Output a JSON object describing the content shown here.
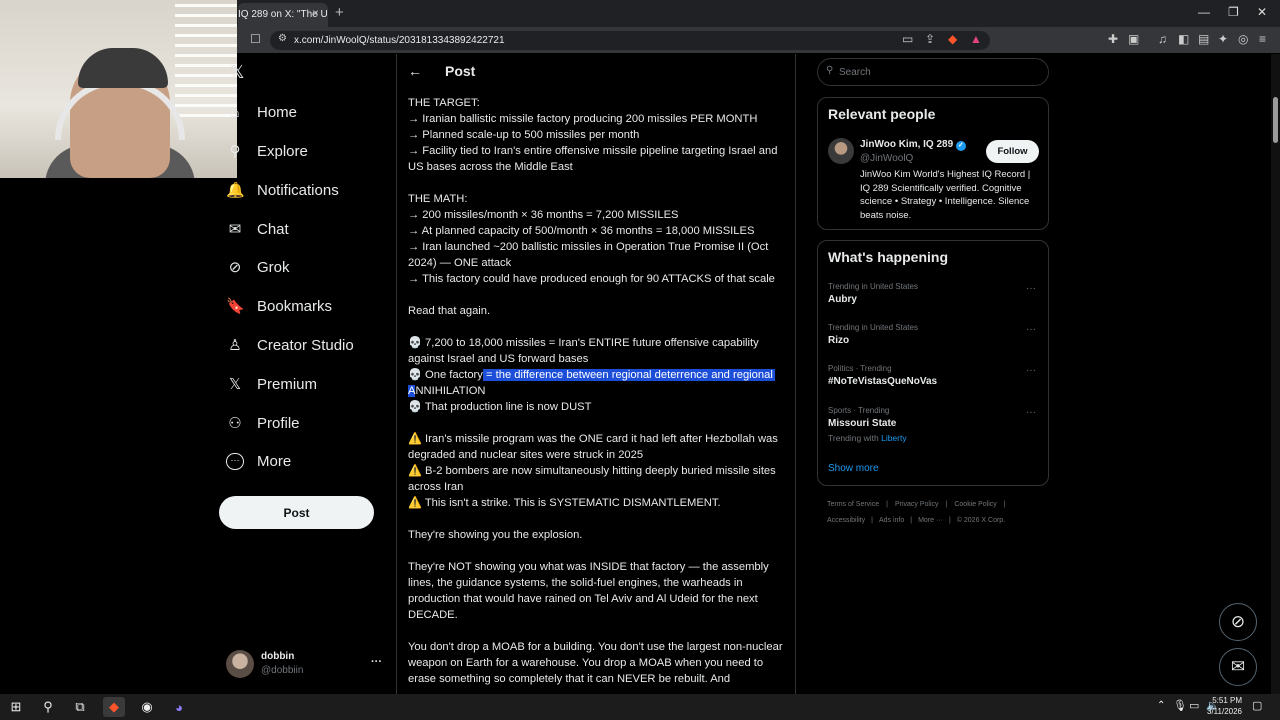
{
  "browser": {
    "tab_title": "IQ 289 on X: \"The U",
    "tab_close": "×",
    "new_tab": "+",
    "url": "x.com/JinWoolQ/status/2031813343892422721",
    "win_min": "—",
    "win_max": "❐",
    "win_close": "✕"
  },
  "nav": {
    "items": [
      {
        "label": "Home",
        "icon": "home-icon",
        "glyph": "⌂"
      },
      {
        "label": "Explore",
        "icon": "search-icon",
        "glyph": "⚲"
      },
      {
        "label": "Notifications",
        "icon": "bell-icon",
        "glyph": "🔔"
      },
      {
        "label": "Chat",
        "icon": "mail-icon",
        "glyph": "✉"
      },
      {
        "label": "Grok",
        "icon": "grok-icon",
        "glyph": "⊘"
      },
      {
        "label": "Bookmarks",
        "icon": "bookmark-icon",
        "glyph": "🔖"
      },
      {
        "label": "Creator Studio",
        "icon": "creator-studio-icon",
        "glyph": "♙"
      },
      {
        "label": "Premium",
        "icon": "x-logo-icon",
        "glyph": "𝕏"
      },
      {
        "label": "Profile",
        "icon": "person-icon",
        "glyph": "⚇"
      },
      {
        "label": "More",
        "icon": "more-circle-icon",
        "glyph": "⋯"
      }
    ],
    "post_button": "Post",
    "account": {
      "name": "dobbin",
      "handle": "@dobbiin",
      "more": "···"
    }
  },
  "header": {
    "back": "←",
    "title": "Post"
  },
  "post": {
    "p1": "THE TARGET:\n→ Iranian ballistic missile factory producing 200 missiles PER MONTH\n→ Planned scale-up to 500 missiles per month\n→ Facility tied to Iran's entire offensive missile pipeline targeting Israel and US bases across the Middle East",
    "p2": "THE MATH:\n→ 200 missiles/month × 36 months = 7,200 MISSILES\n→ At planned capacity of 500/month × 36 months = 18,000 MISSILES\n→ Iran launched ~200 ballistic missiles in Operation True Promise II (Oct 2024) — ONE attack\n→ This factory could have produced enough for 90 ATTACKS of that scale",
    "p3": "Read that again.",
    "p4a": "💀 7,200 to 18,000 missiles = Iran's ENTIRE future offensive capability against Israel and US forward bases\n💀 One factory",
    "p4sel": " = the difference between regional deterrence and regional A",
    "p4b": "NNIHILATION\n💀 That production line is now DUST",
    "p5": "⚠️ Iran's missile program was the ONE card it had left after Hezbollah was degraded and nuclear sites were struck in 2025\n⚠️ B-2 bombers are now simultaneously hitting deeply buried missile sites across Iran\n⚠️ This isn't a strike. This is SYSTEMATIC DISMANTLEMENT.",
    "p6": "They're showing you the explosion.",
    "p7": "They're NOT showing you what was INSIDE that factory — the assembly lines, the guidance systems, the solid-fuel engines, the warheads in production that would have rained on Tel Aviv and Al Udeid for the next DECADE.",
    "p8": "You don't drop a MOAB for a building. You don't use the largest non-nuclear weapon on Earth for a warehouse. You drop a MOAB when you need to erase something so completely that it can NEVER be rebuilt. And"
  },
  "search": {
    "placeholder": "Search"
  },
  "relevant": {
    "title": "Relevant people",
    "name": "JinWoo Kim, IQ 289",
    "handle": "@JinWoolQ",
    "follow": "Follow",
    "bio": "JinWoo Kim World's Highest IQ Record | IQ 289 Scientifically verified. Cognitive science • Strategy • Intelligence. Silence beats noise."
  },
  "trends": {
    "title": "What's happening",
    "items": [
      {
        "context": "Trending in United States",
        "name": "Aubry",
        "extra": ""
      },
      {
        "context": "Trending in United States",
        "name": "Rizo",
        "extra": ""
      },
      {
        "context": "Politics · Trending",
        "name": "#NoTeVistasQueNoVas",
        "extra": ""
      },
      {
        "context": "Sports · Trending",
        "name": "Missouri State",
        "extra": "Trending with"
      }
    ],
    "trending_with_link": "Liberty",
    "show_more": "Show more",
    "more_dots": "···"
  },
  "footer": {
    "line1": [
      "Terms of Service",
      "|",
      "Privacy Policy",
      "|",
      "Cookie Policy",
      "|"
    ],
    "line2": [
      "Accessibility",
      "|",
      "Ads info",
      "|",
      "More ···",
      "|",
      "© 2026 X Corp."
    ]
  },
  "taskbar": {
    "time": "5:51 PM",
    "date": "3/11/2026"
  },
  "colors": {
    "accent": "#1d9bf0",
    "selection": "#1d4ed8",
    "background": "#000000",
    "border": "#2f3336"
  }
}
